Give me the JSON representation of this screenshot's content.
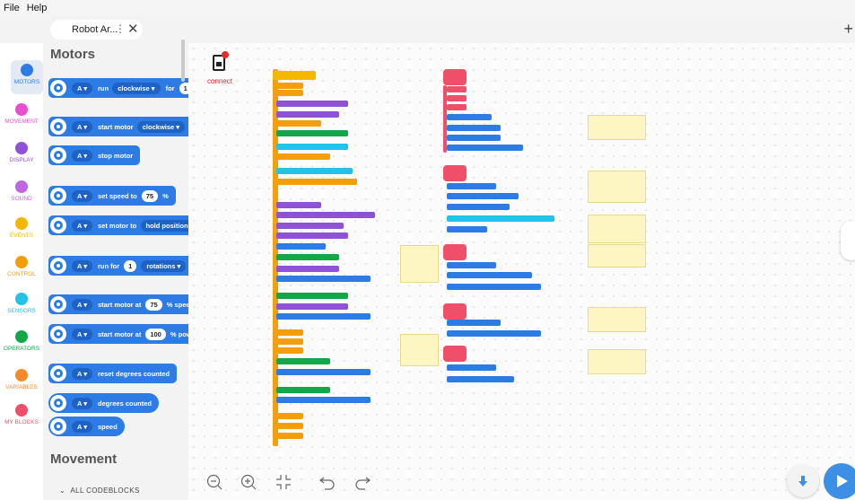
{
  "menu": {
    "file": "File",
    "help": "Help"
  },
  "tab": {
    "title": "Robot Ar...",
    "menu_glyph": "⋮",
    "close_glyph": "✕",
    "add_glyph": "+"
  },
  "categories": [
    {
      "label": "MOTORS",
      "color": "#2d7ce6"
    },
    {
      "label": "MOVEMENT",
      "color": "#e84fd0"
    },
    {
      "label": "DISPLAY",
      "color": "#8f51d6"
    },
    {
      "label": "SOUND",
      "color": "#c066e0"
    },
    {
      "label": "EVENTS",
      "color": "#f5b800"
    },
    {
      "label": "CONTROL",
      "color": "#f59e0b"
    },
    {
      "label": "SENSORS",
      "color": "#22c3e6"
    },
    {
      "label": "OPERATORS",
      "color": "#12a84a"
    },
    {
      "label": "VARIABLES",
      "color": "#f58a2a"
    },
    {
      "label": "MY BLOCKS",
      "color": "#f04f6a"
    }
  ],
  "palette": {
    "heading_motors": "Motors",
    "heading_movement": "Movement",
    "all_codeblocks": "ALL CODEBLOCKS",
    "blocks": [
      {
        "port": "A",
        "text1": "run",
        "drop": "clockwise",
        "text2": "for",
        "value": "1"
      },
      {
        "port": "A",
        "text1": "start motor",
        "drop": "clockwise"
      },
      {
        "port": "A",
        "text1": "stop motor"
      },
      {
        "port": "A",
        "text1": "set speed to",
        "value": "75",
        "text2": "%"
      },
      {
        "port": "A",
        "text1": "set motor to",
        "drop": "hold position"
      },
      {
        "port": "A",
        "text1": "run for",
        "value": "1",
        "drop": "rotations"
      },
      {
        "port": "A",
        "text1": "start motor at",
        "value": "75",
        "text2": "% speed"
      },
      {
        "port": "A",
        "text1": "start motor at",
        "value": "100",
        "text2": "% powe"
      },
      {
        "port": "A",
        "text1": "reset degrees counted"
      },
      {
        "port": "A",
        "text1": "degrees counted"
      },
      {
        "port": "A",
        "text1": "speed"
      }
    ]
  },
  "canvas": {
    "connect_label": "connect"
  },
  "colors": {
    "motors": "#2d7ce6",
    "events": "#f5b800",
    "control": "#f59e0b",
    "display": "#8f51d6",
    "sensors": "#22c3e6",
    "operators": "#12a84a",
    "myblocks": "#f04f6a"
  },
  "controls": {
    "zoom_out": "zoom-out-icon",
    "zoom_in": "zoom-in-icon",
    "fit": "fit-icon",
    "undo": "undo-icon",
    "redo": "redo-icon"
  }
}
